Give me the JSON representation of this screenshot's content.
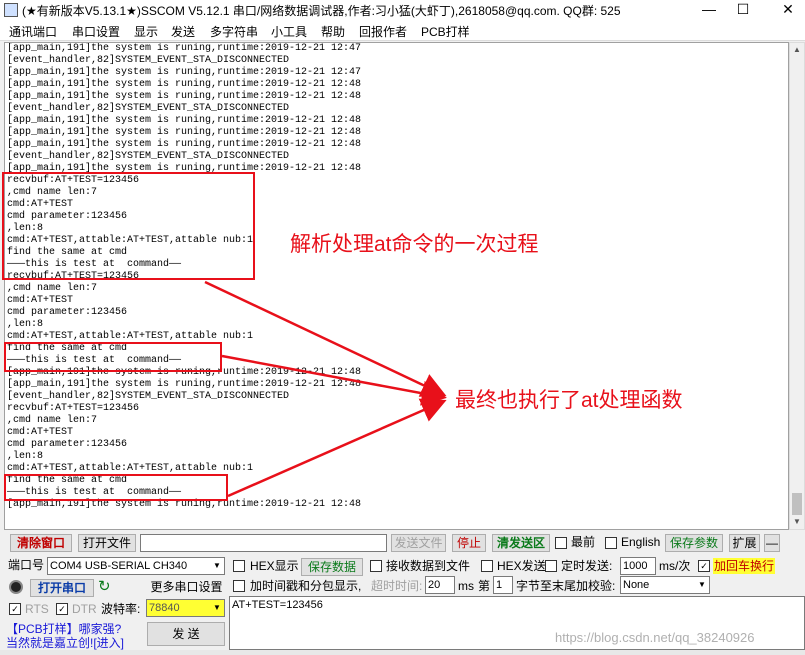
{
  "window": {
    "title": "(★有新版本V5.13.1★)SSCOM V5.12.1 串口/网络数据调试器,作者:习小猛(大虾丁),2618058@qq.com. QQ群: 525",
    "minimize": "—",
    "maximize": "☐",
    "close": "✕"
  },
  "menu": [
    "通讯端口",
    "串口设置",
    "显示",
    "发送",
    "多字符串",
    "小工具",
    "帮助",
    "回报作者",
    "PCB打样"
  ],
  "log": [
    "[app_main,191]the system is runing,runtime:2019-12-21 12:47",
    "[event_handler,82]SYSTEM_EVENT_STA_DISCONNECTED",
    "[app_main,191]the system is runing,runtime:2019-12-21 12:47",
    "[app_main,191]the system is runing,runtime:2019-12-21 12:48",
    "[app_main,191]the system is runing,runtime:2019-12-21 12:48",
    "[event_handler,82]SYSTEM_EVENT_STA_DISCONNECTED",
    "[app_main,191]the system is runing,runtime:2019-12-21 12:48",
    "[app_main,191]the system is runing,runtime:2019-12-21 12:48",
    "[app_main,191]the system is runing,runtime:2019-12-21 12:48",
    "[event_handler,82]SYSTEM_EVENT_STA_DISCONNECTED",
    "[app_main,191]the system is runing,runtime:2019-12-21 12:48",
    "recvbuf:AT+TEST=123456",
    ",cmd name len:7",
    "cmd:AT+TEST",
    "cmd parameter:123456",
    ",len:8",
    "cmd:AT+TEST,attable:AT+TEST,attable nub:1",
    "find the same at cmd",
    "———this is test at  command——",
    "recvbuf:AT+TEST=123456",
    ",cmd name len:7",
    "cmd:AT+TEST",
    "cmd parameter:123456",
    ",len:8",
    "cmd:AT+TEST,attable:AT+TEST,attable nub:1",
    "find the same at cmd",
    "———this is test at  command——",
    "[app_main,191]the system is runing,runtime:2019-12-21 12:48",
    "[app_main,191]the system is runing,runtime:2019-12-21 12:48",
    "[event_handler,82]SYSTEM_EVENT_STA_DISCONNECTED",
    "recvbuf:AT+TEST=123456",
    ",cmd name len:7",
    "cmd:AT+TEST",
    "cmd parameter:123456",
    ",len:8",
    "cmd:AT+TEST,attable:AT+TEST,attable nub:1",
    "find the same at cmd",
    "———this is test at  command——",
    "[app_main,191]the system is runing,runtime:2019-12-21 12:48"
  ],
  "annotations": {
    "first": "解析处理at命令的一次过程",
    "second": "最终也执行了at处理函数"
  },
  "toolbar": {
    "clear_window": "清除窗口",
    "open_file": "打开文件",
    "send_file": "发送文件",
    "stop": "停止",
    "clear_send": "清发送区",
    "latest": "最前",
    "english": "English",
    "save_params": "保存参数",
    "expand": "扩展",
    "collapse": "—"
  },
  "port": {
    "label": "端口号",
    "value": "COM4 USB-SERIAL CH340",
    "open_button": "打开串口",
    "more_settings": "更多串口设置",
    "rts": "RTS",
    "dtr": "DTR",
    "baud_label": "波特率:",
    "baud_value": "78840"
  },
  "options": {
    "hex_display": "HEX显示",
    "save_data": "保存数据",
    "recv_to_file": "接收数据到文件",
    "hex_send": "HEX发送",
    "timed_send": "定时发送:",
    "interval": "1000",
    "unit": "ms/次",
    "add_crlf": "加回车换行",
    "timestamp": "加时间戳和分包显示,",
    "timeout_label": "超时时间:",
    "timeout_value": "20",
    "ms": "ms",
    "page_label": "第",
    "byte_value": "1",
    "checksum_label": "字节至末尾加校验:",
    "checksum_value": "None"
  },
  "send_box": {
    "text": "AT+TEST=123456",
    "send_button": "发 送"
  },
  "promo": {
    "line1": "【PCB打样】哪家强?",
    "line2": "当然就是嘉立创![进入]"
  },
  "watermark": "https://blog.csdn.net/qq_38240926",
  "colors": {
    "annotation_red": "#e8101a",
    "button_green": "#0a7a1a",
    "promo_blue": "#1a1ad8",
    "baud_bg": "#ffff33"
  }
}
